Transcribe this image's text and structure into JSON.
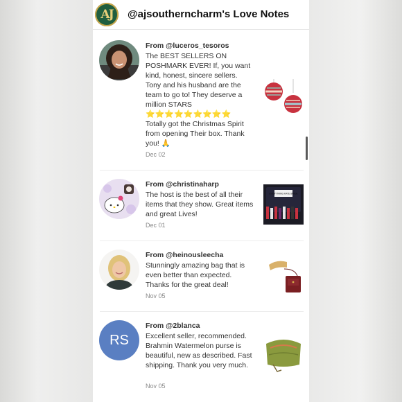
{
  "header": {
    "logo_text": "AJ",
    "title": "@ajsoutherncharm's Love Notes"
  },
  "notes": [
    {
      "from": "From @luceros_tesoros",
      "text_before": "The BEST SELLERS ON POSHMARK EVER! If, you want kind, honest, sincere sellers. Tony and his husband are the team to go to! They deserve a million STARS",
      "stars": "⭐⭐⭐⭐⭐⭐⭐⭐⭐",
      "text_after": "Totally got the Christmas Spirit from opening Their box. Thank you! 🙏",
      "date": "Dec 02",
      "thumbnail": "christmas-ornaments"
    },
    {
      "from": "From @christinaharp",
      "text": "The host is the best of all their items that they show. Great items and great Lives!",
      "date": "Dec 01",
      "thumbnail": "kate-spade-stage",
      "thumb_text": "EVERYTHING KATE SPADE"
    },
    {
      "from": "From @heinousleecha",
      "text": "Stunningly amazing bag that is even better than expected. Thanks for the great deal!",
      "date": "Nov 05",
      "thumbnail": "red-crossbody-bag"
    },
    {
      "from": "From @2blanca",
      "avatar_initials": "RS",
      "text": "Excellent seller, recommended. Brahmin Watermelon purse is beautiful, new as described. Fast shipping. Thank you very much.",
      "date": "Nov 05",
      "thumbnail": "green-croc-purse"
    }
  ],
  "colors": {
    "logo_bg": "#1f5e3f",
    "logo_gold": "#c9a649",
    "initials_avatar": "#5a7fc2",
    "star": "#f4c430"
  }
}
